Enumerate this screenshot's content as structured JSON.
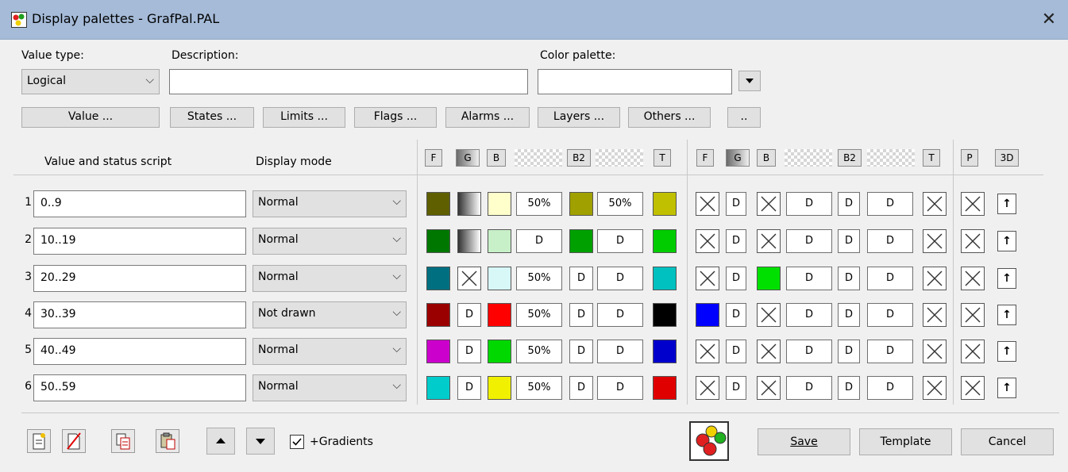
{
  "window": {
    "title": "Display palettes - GrafPal.PAL",
    "close_glyph": "✕"
  },
  "labels": {
    "value_type": "Value type:",
    "description": "Description:",
    "color_palette": "Color palette:"
  },
  "value_type": {
    "selected": "Logical"
  },
  "description": {
    "value": ""
  },
  "color_palette": {
    "value": ""
  },
  "toolbar": {
    "buttons": [
      "Value ...",
      "States ...",
      "Limits ...",
      "Flags ...",
      "Alarms ...",
      "Layers ...",
      "Others ...",
      ".."
    ]
  },
  "columns": {
    "script": "Value and status script",
    "mode": "Display mode",
    "group1": [
      "F",
      "G",
      "B",
      "B2",
      "T"
    ],
    "group2": [
      "F",
      "G",
      "B",
      "B2",
      "T"
    ],
    "group3": [
      "P",
      "3D"
    ]
  },
  "rows": [
    {
      "num": "1",
      "script": "0..9",
      "mode": "Normal",
      "f": "#5f5f00",
      "g": "gradient",
      "b": "#ffffcc",
      "op1": "50%",
      "b2": "#a0a000",
      "op2": "50%",
      "t": "#c0c000",
      "f2": "X",
      "g2": "D",
      "b3": "X",
      "op3": "D",
      "b4": "D",
      "op4": "D",
      "t2": "X",
      "p": "X",
      "d3": "↑"
    },
    {
      "num": "2",
      "script": "10..19",
      "mode": "Normal",
      "f": "#007800",
      "g": "gradient",
      "b": "#c8f0c8",
      "op1": "D",
      "b2": "#00a000",
      "op2": "D",
      "t": "#00cc00",
      "f2": "X",
      "g2": "D",
      "b3": "X",
      "op3": "D",
      "b4": "D",
      "op4": "D",
      "t2": "X",
      "p": "X",
      "d3": "↑"
    },
    {
      "num": "3",
      "script": "20..29",
      "mode": "Normal",
      "f": "#007080",
      "g": "X",
      "b": "#d8f8f8",
      "op1": "50%",
      "b2": "D",
      "op2": "D",
      "t": "#00c0c0",
      "f2": "X",
      "g2": "D",
      "b3": "#00e000",
      "op3": "D",
      "b4": "D",
      "op4": "D",
      "t2": "X",
      "p": "X",
      "d3": "↑"
    },
    {
      "num": "4",
      "script": "30..39",
      "mode": "Not drawn",
      "f": "#9a0000",
      "g": "D",
      "b": "#ff0000",
      "op1": "50%",
      "b2": "D",
      "op2": "D",
      "t": "#000000",
      "f2": "#0000ff",
      "g2": "D",
      "b3": "X",
      "op3": "D",
      "b4": "D",
      "op4": "D",
      "t2": "X",
      "p": "X",
      "d3": "↑"
    },
    {
      "num": "5",
      "script": "40..49",
      "mode": "Normal",
      "f": "#cc00cc",
      "g": "D",
      "b": "#00d800",
      "op1": "50%",
      "b2": "D",
      "op2": "D",
      "t": "#0000cc",
      "f2": "X",
      "g2": "D",
      "b3": "X",
      "op3": "D",
      "b4": "D",
      "op4": "D",
      "t2": "X",
      "p": "X",
      "d3": "↑"
    },
    {
      "num": "6",
      "script": "50..59",
      "mode": "Normal",
      "f": "#00cccc",
      "g": "D",
      "b": "#f0f000",
      "op1": "50%",
      "b2": "D",
      "op2": "D",
      "t": "#e00000",
      "f2": "X",
      "g2": "D",
      "b3": "X",
      "op3": "D",
      "b4": "D",
      "op4": "D",
      "t2": "X",
      "p": "X",
      "d3": "↑"
    }
  ],
  "bottom": {
    "icons": [
      "new-row-icon",
      "delete-row-icon",
      "copy-icon",
      "paste-icon",
      "move-up-icon",
      "move-down-icon"
    ],
    "gradients_label": "+Gradients",
    "gradients_checked": true,
    "save": "Save",
    "template": "Template",
    "cancel": "Cancel"
  }
}
